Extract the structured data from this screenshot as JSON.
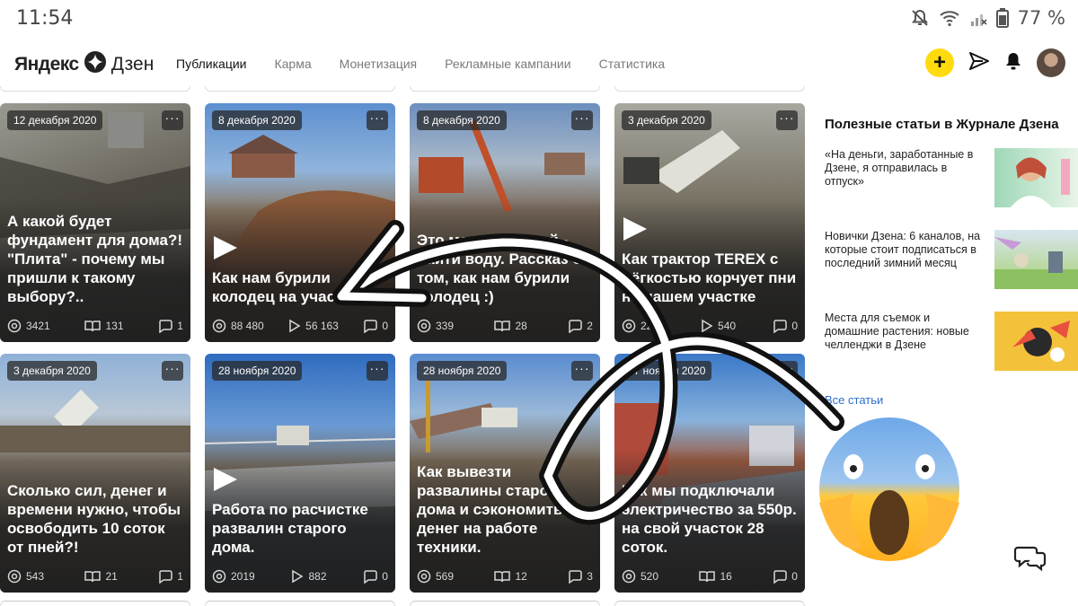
{
  "status_bar": {
    "time": "11:54",
    "battery": "77 %"
  },
  "brand": {
    "name_bold": "Яндекс",
    "name_light": "Дзен"
  },
  "nav": {
    "tabs": [
      {
        "label": "Публикации",
        "active": true
      },
      {
        "label": "Карма",
        "active": false
      },
      {
        "label": "Монетизация",
        "active": false
      },
      {
        "label": "Рекламные кампании",
        "active": false
      },
      {
        "label": "Статистика",
        "active": false
      }
    ],
    "add_label": "+"
  },
  "cards": [
    {
      "date": "12 декабря 2020",
      "title": "А какой будет фундамент для дома?! \"Плита\" - почему мы пришли к такому выбору?..",
      "video": false,
      "views": "3421",
      "reads": "131",
      "comments": "1"
    },
    {
      "date": "8 декабря 2020",
      "title": "Как нам бурили колодец на участке",
      "video": true,
      "views": "88 480",
      "reads": "56 163",
      "comments": "0"
    },
    {
      "date": "8 декабря 2020",
      "title": "Это может каждый - найти воду. Рассказ о том, как нам бурили колодец :)",
      "video": false,
      "views": "339",
      "reads": "28",
      "comments": "2"
    },
    {
      "date": "3 декабря 2020",
      "title": "Как трактор TEREX с лёгкостью корчует пни на нашем участке",
      "video": true,
      "views": "2211",
      "reads": "540",
      "comments": "0"
    },
    {
      "date": "3 декабря 2020",
      "title": "Сколько сил, денег и времени нужно, чтобы освободить 10 соток от пней?!",
      "video": false,
      "views": "543",
      "reads": "21",
      "comments": "1"
    },
    {
      "date": "28 ноября 2020",
      "title": "Работа по расчистке развалин старого дома.",
      "video": true,
      "views": "2019",
      "reads": "882",
      "comments": "0"
    },
    {
      "date": "28 ноября 2020",
      "title": "Как вывезти развалины старого дома и сэкономить денег на работе техники.",
      "video": false,
      "views": "569",
      "reads": "12",
      "comments": "3"
    },
    {
      "date": "27 ноября 2020",
      "title": "Как мы подключали электричество за 550р. на свой участок 28 соток.",
      "video": false,
      "views": "520",
      "reads": "16",
      "comments": "0"
    }
  ],
  "sidebar": {
    "title": "Полезные статьи в Журнале Дзена",
    "articles": [
      {
        "text": "«На деньги, заработанные в Дзене, я отправилась в отпуск»"
      },
      {
        "text": "Новички Дзена: 6 каналов, на которые стоит подписаться в последний зимний месяц"
      },
      {
        "text": "Места для съемок и домашние растения: новые челленджи в Дзене"
      }
    ],
    "all_link": "Все статьи"
  },
  "colors": {
    "accent_yellow": "#ffdb0d",
    "link_blue": "#2b6fcf",
    "nav_inactive": "#7a7a7a"
  }
}
